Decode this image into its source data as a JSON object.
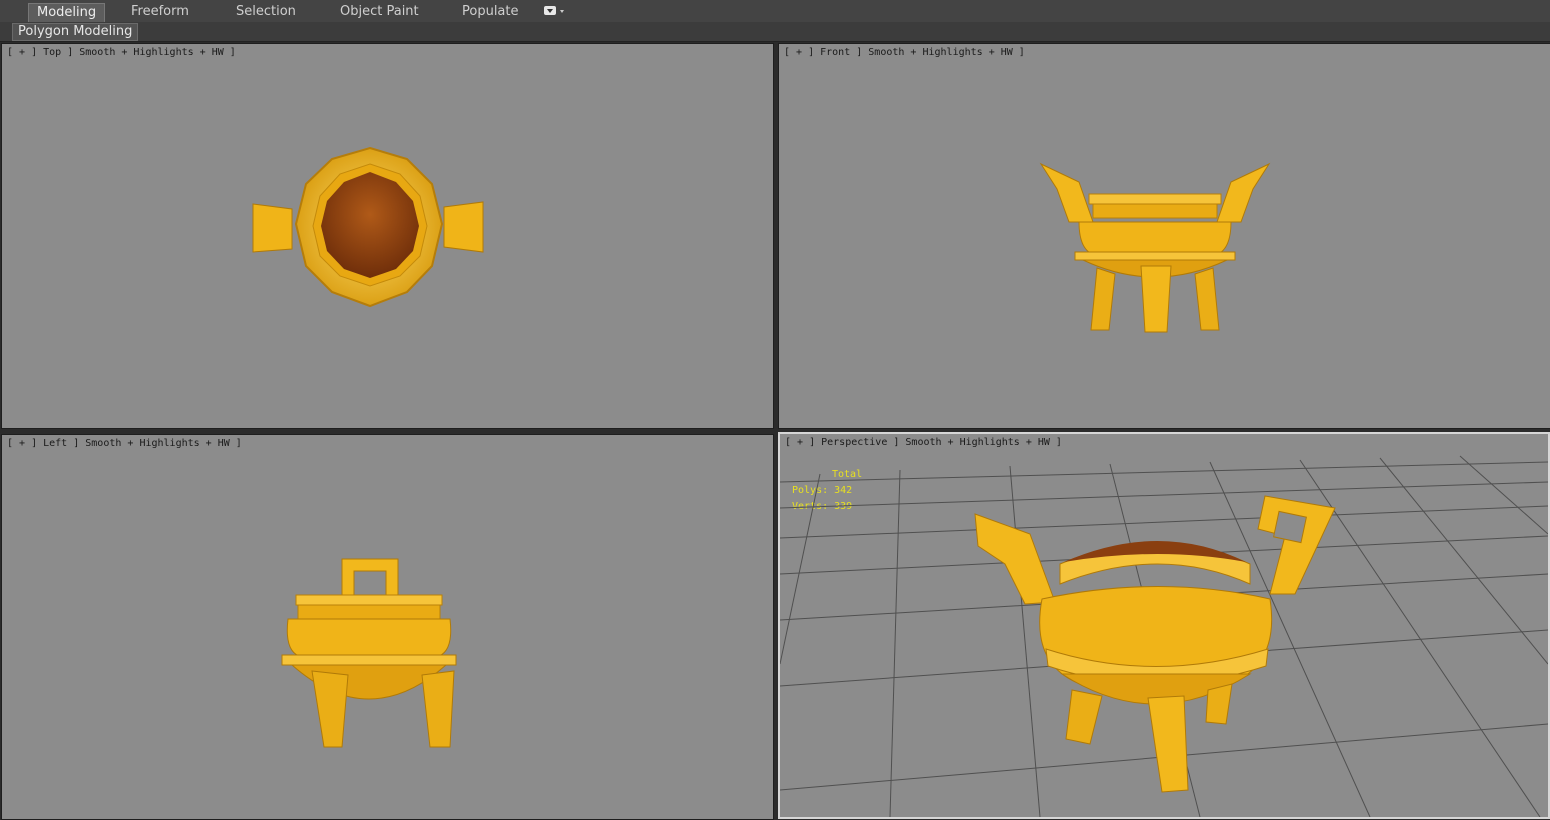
{
  "ribbon": {
    "tabs": [
      "Modeling",
      "Freeform",
      "Selection",
      "Object Paint",
      "Populate"
    ],
    "active_tab": "Modeling",
    "sub_label": "Polygon Modeling"
  },
  "viewports": {
    "top": {
      "label": "[ + ] Top ] Smooth + Highlights + HW ]"
    },
    "front": {
      "label": "[ + ] Front ] Smooth + Highlights + HW ]"
    },
    "left": {
      "label": "[ + ] Left ] Smooth + Highlights + HW ]"
    },
    "perspective": {
      "label": "[ + ] Perspective ] Smooth + Highlights + HW ]"
    }
  },
  "stats": {
    "title": "Total",
    "polys": "Polys: 342",
    "verts": "Verts: 339"
  },
  "colors": {
    "viewport_bg": "#8c8c8c",
    "gold": "#f2b81c",
    "gold_dark": "#c98a08",
    "bowl_inside": "#8a3f10",
    "stats_text": "#e8e020"
  }
}
